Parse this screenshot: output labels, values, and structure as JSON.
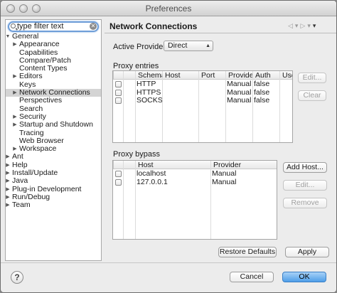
{
  "window": {
    "title": "Preferences"
  },
  "filter": {
    "value": "type filter text"
  },
  "tree": [
    {
      "label": "General",
      "level": 0,
      "expanded": true
    },
    {
      "label": "Appearance",
      "level": 1,
      "has_children": true
    },
    {
      "label": "Capabilities",
      "level": 1
    },
    {
      "label": "Compare/Patch",
      "level": 1
    },
    {
      "label": "Content Types",
      "level": 1
    },
    {
      "label": "Editors",
      "level": 1,
      "has_children": true
    },
    {
      "label": "Keys",
      "level": 1
    },
    {
      "label": "Network Connections",
      "level": 1,
      "has_children": true,
      "selected": true
    },
    {
      "label": "Perspectives",
      "level": 1
    },
    {
      "label": "Search",
      "level": 1
    },
    {
      "label": "Security",
      "level": 1,
      "has_children": true
    },
    {
      "label": "Startup and Shutdown",
      "level": 1,
      "has_children": true
    },
    {
      "label": "Tracing",
      "level": 1
    },
    {
      "label": "Web Browser",
      "level": 1
    },
    {
      "label": "Workspace",
      "level": 1,
      "has_children": true
    },
    {
      "label": "Ant",
      "level": 0,
      "has_children": true
    },
    {
      "label": "Help",
      "level": 0,
      "has_children": true
    },
    {
      "label": "Install/Update",
      "level": 0,
      "has_children": true
    },
    {
      "label": "Java",
      "level": 0,
      "has_children": true
    },
    {
      "label": "Plug-in Development",
      "level": 0,
      "has_children": true
    },
    {
      "label": "Run/Debug",
      "level": 0,
      "has_children": true
    },
    {
      "label": "Team",
      "level": 0,
      "has_children": true
    }
  ],
  "page": {
    "title": "Network Connections",
    "active_provider_label": "Active Provider:",
    "active_provider_value": "Direct",
    "proxy_entries_label": "Proxy entries",
    "proxy_bypass_label": "Proxy bypass"
  },
  "proxy_entries": {
    "columns": [
      "Schema",
      "Host",
      "Port",
      "Provider",
      "Auth",
      "User"
    ],
    "rows": [
      [
        "HTTP",
        "",
        "",
        "Manual",
        "false",
        ""
      ],
      [
        "HTTPS",
        "",
        "",
        "Manual",
        "false",
        ""
      ],
      [
        "SOCKS",
        "",
        "",
        "Manual",
        "false",
        ""
      ]
    ],
    "edit_label": "Edit...",
    "clear_label": "Clear"
  },
  "proxy_bypass": {
    "columns": [
      "Host",
      "Provider"
    ],
    "rows": [
      [
        "localhost",
        "Manual"
      ],
      [
        "127.0.0.1",
        "Manual"
      ]
    ],
    "add_label": "Add Host...",
    "edit_label": "Edit...",
    "remove_label": "Remove"
  },
  "buttons": {
    "restore": "Restore Defaults",
    "apply": "Apply",
    "cancel": "Cancel",
    "ok": "OK",
    "help": "?"
  }
}
